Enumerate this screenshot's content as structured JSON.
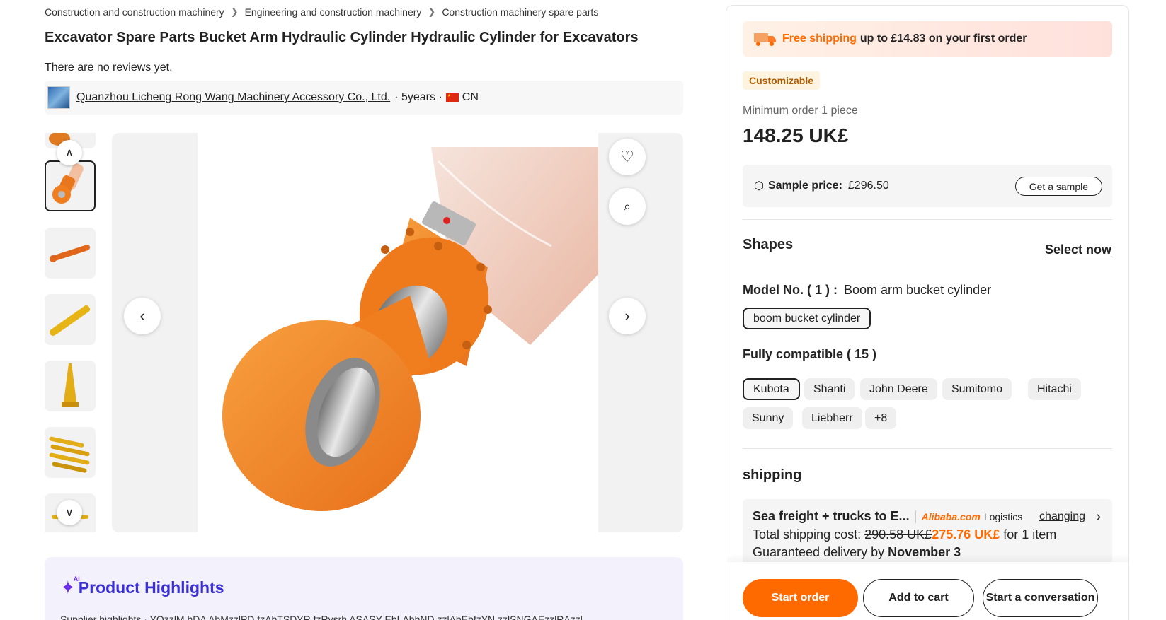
{
  "breadcrumb": [
    "Construction and construction machinery",
    "Engineering and construction machinery",
    "Construction machinery spare parts"
  ],
  "product": {
    "title": "Excavator Spare Parts Bucket Arm Hydraulic Cylinder Hydraulic Cylinder for Excavators",
    "reviews": "There are no reviews yet."
  },
  "supplier": {
    "name": "Quanzhou Licheng Rong Wang Machinery Accessory Co., Ltd.",
    "years": "· 5years ·",
    "country": "CN"
  },
  "gallery": {
    "thumb_count": 6,
    "selected_index": 0
  },
  "highlights": {
    "title": "Product Highlights",
    "ai_label": "AI",
    "subtitle": "Supplier highlights · YQzzlM hDA AbMzzlPD fzAbTSDYR fzRysrh ASASY EbLAbhND zzlAbEbfzYN zzlSNGAEzzlRAzzl"
  },
  "panel": {
    "shipping_banner": {
      "highlight": "Free shipping",
      "text": "up to £14.83 on your first order"
    },
    "badge": "Customizable",
    "min_order": "Minimum order 1 piece",
    "price": "148.25 UK£",
    "sample": {
      "label": "Sample price:",
      "value": "£296.50",
      "button": "Get a sample"
    },
    "shapes": {
      "title": "Shapes",
      "select_now": "Select now",
      "model_label": "Model No. ( 1 ) :",
      "model_value": "Boom arm bucket cylinder",
      "model_option": "boom bucket cylinder",
      "compat_title": "Fully compatible ( 15 )",
      "compat": [
        "Kubota",
        "Shanti",
        "John Deere",
        "Sumitomo",
        "Hitachi",
        "Sunny",
        "Liebherr",
        "+8"
      ]
    },
    "shipping": {
      "title": "shipping",
      "method": "Sea freight + trucks to E...",
      "alibaba": "Alibaba.com",
      "logistics": "Logistics",
      "changing": "changing",
      "cost_label": "Total shipping cost:",
      "old_cost": "290.58 UK£",
      "new_cost": "275.76 UK£",
      "cost_suffix": "for 1 item",
      "delivery_label": "Guaranteed delivery by",
      "delivery_date": "November 3"
    },
    "actions": {
      "start_order": "Start order",
      "add_to_cart": "Add to cart",
      "conversation": "Start a conversation"
    }
  },
  "colors": {
    "accent": "#ff6a00",
    "highlight_purple": "#3a2fd6",
    "cylinder_orange": "#f07d1e"
  },
  "icons": [
    "chevron-right-icon",
    "chevron-up-icon",
    "chevron-down-icon",
    "chevron-left-icon",
    "heart-icon",
    "image-search-icon",
    "truck-icon",
    "cube-icon",
    "sparkle-icon"
  ]
}
